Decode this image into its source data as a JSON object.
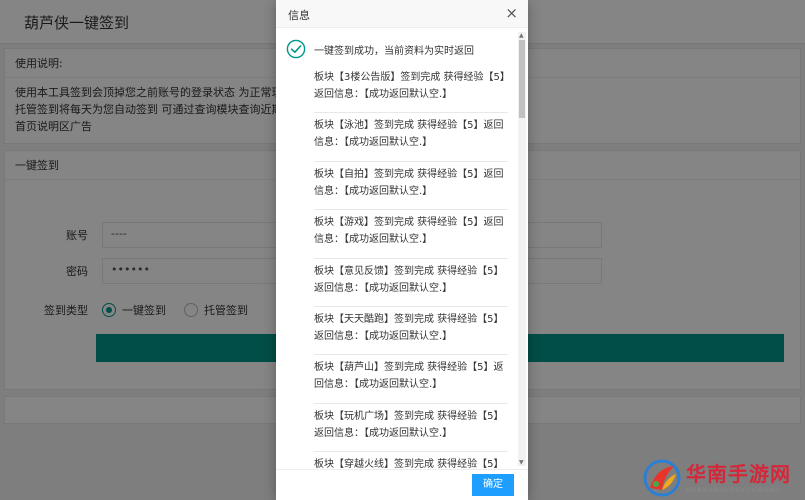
{
  "app": {
    "title": "葫芦侠一键签到"
  },
  "instructions": {
    "title": "使用说明:",
    "lines": [
      "使用本工具签到会顶掉您之前账号的登录状态 为正常现象。",
      "托管签到将每天为您自动签到 可通过查询模块查询近期签到日",
      "首页说明区广告"
    ]
  },
  "signin_form": {
    "title": "一键签到",
    "account_label": "账号",
    "account_value": "----",
    "password_label": "密码",
    "password_value": "••••••",
    "type_label": "签到类型",
    "options": [
      {
        "label": "一键签到",
        "checked": true
      },
      {
        "label": "托管签到",
        "checked": false
      }
    ],
    "accent_color": "#009688"
  },
  "modal": {
    "title": "信息",
    "close_symbol": "×",
    "result_text": "一键签到成功，当前资料为实时返回",
    "entries": [
      "板块【3楼公告版】签到完成 获得经验【5】返回信息：【成功返回默认空.】",
      "板块【泳池】签到完成 获得经验【5】返回信息：【成功返回默认空.】",
      "板块【自拍】签到完成 获得经验【5】返回信息：【成功返回默认空.】",
      "板块【游戏】签到完成 获得经验【5】返回信息：【成功返回默认空.】",
      "板块【意见反馈】签到完成 获得经验【5】返回信息：【成功返回默认空.】",
      "板块【天天酷跑】签到完成 获得经验【5】返回信息：【成功返回默认空.】",
      "板块【葫芦山】签到完成 获得经验【5】返回信息：【成功返回默认空.】",
      "板块【玩机广场】签到完成 获得经验【5】返回信息：【成功返回默认空.】",
      "板块【穿越火线】签到完成 获得经验【5】"
    ],
    "ok_label": "确定",
    "ok_color": "#1e9fff",
    "check_color": "#009688"
  },
  "watermark": {
    "main": "华南手游网",
    "sub": "HUANANSHOUYOUWANG",
    "color": "#d4283a"
  }
}
